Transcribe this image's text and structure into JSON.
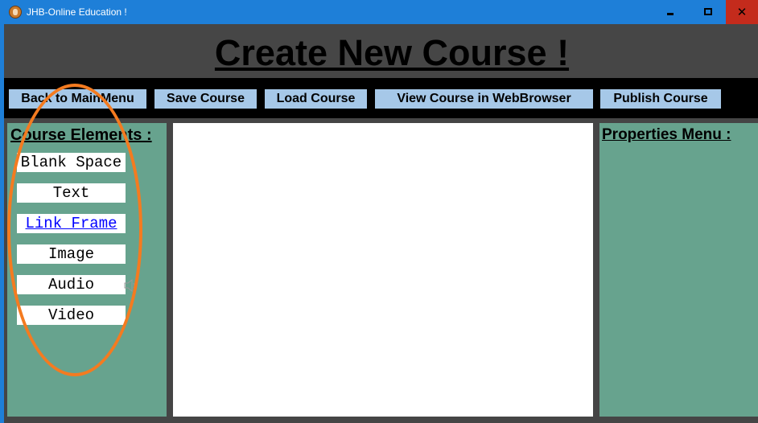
{
  "window": {
    "title": "JHB-Online Education !",
    "controls": {
      "minimize": "minimize",
      "maximize": "maximize",
      "close": "✕"
    }
  },
  "header": {
    "title": "Create New Course !"
  },
  "toolbar": {
    "back_label": "Back to MainMenu",
    "save_label": "Save Course",
    "load_label": "Load Course",
    "view_label": "View Course in WebBrowser",
    "publish_label": "Publish Course"
  },
  "course_elements": {
    "heading": "Course Elements :",
    "items": [
      {
        "label": "Blank Space"
      },
      {
        "label": "Text"
      },
      {
        "label": "Link Frame"
      },
      {
        "label": "Image"
      },
      {
        "label": "Audio",
        "icon": "speaker-icon"
      },
      {
        "label": "Video"
      }
    ]
  },
  "properties": {
    "heading": "Properties Menu :"
  },
  "colors": {
    "titlebar": "#1e7fd8",
    "background": "#454545",
    "toolbar": "#000000",
    "toolbar_button": "#a6c8e8",
    "panel": "#67a38e",
    "link": "#0000ff",
    "annotation": "#f47b20",
    "close_button": "#c42b1c"
  }
}
